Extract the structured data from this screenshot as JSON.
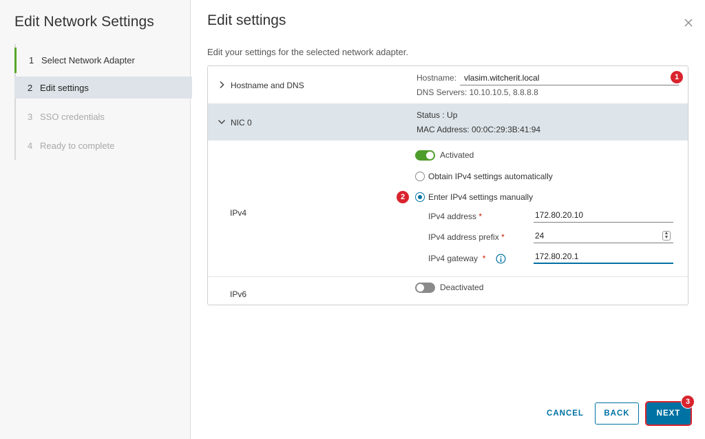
{
  "wizard": {
    "title": "Edit Network Settings",
    "steps": [
      {
        "num": "1",
        "label": "Select Network Adapter"
      },
      {
        "num": "2",
        "label": "Edit settings"
      },
      {
        "num": "3",
        "label": "SSO credentials"
      },
      {
        "num": "4",
        "label": "Ready to complete"
      }
    ]
  },
  "content": {
    "title": "Edit settings",
    "subtitle": "Edit your settings for the selected network adapter."
  },
  "hostname_section": {
    "label": "Hostname and DNS",
    "hostname_label": "Hostname:",
    "hostname_value": "vlasim.witcherit.local",
    "dns_servers": "DNS Servers: 10.10.10.5, 8.8.8.8"
  },
  "nic_section": {
    "label": "NIC 0",
    "status": "Status : Up",
    "mac": "MAC Address: 00:0C:29:3B:41:94"
  },
  "ipv4": {
    "label": "IPv4",
    "toggle_label": "Activated",
    "activated": true,
    "option_auto": "Obtain IPv4 settings automatically",
    "option_manual": "Enter IPv4 settings manually",
    "selected": "manual",
    "address_label": "IPv4 address",
    "address_value": "172.80.20.10",
    "prefix_label": "IPv4 address prefix",
    "prefix_value": "24",
    "gateway_label": "IPv4 gateway",
    "gateway_value": "172.80.20.1",
    "required_mark": "*"
  },
  "ipv6": {
    "label": "IPv6",
    "toggle_label": "Deactivated",
    "activated": false
  },
  "annotations": [
    "1",
    "2",
    "3"
  ],
  "buttons": {
    "cancel": "CANCEL",
    "back": "BACK",
    "next": "NEXT"
  },
  "colors": {
    "accent": "#0072a3",
    "toggle_on": "#4d9d2a",
    "annotation": "#d9232d",
    "completed_step": "#59a52c"
  }
}
